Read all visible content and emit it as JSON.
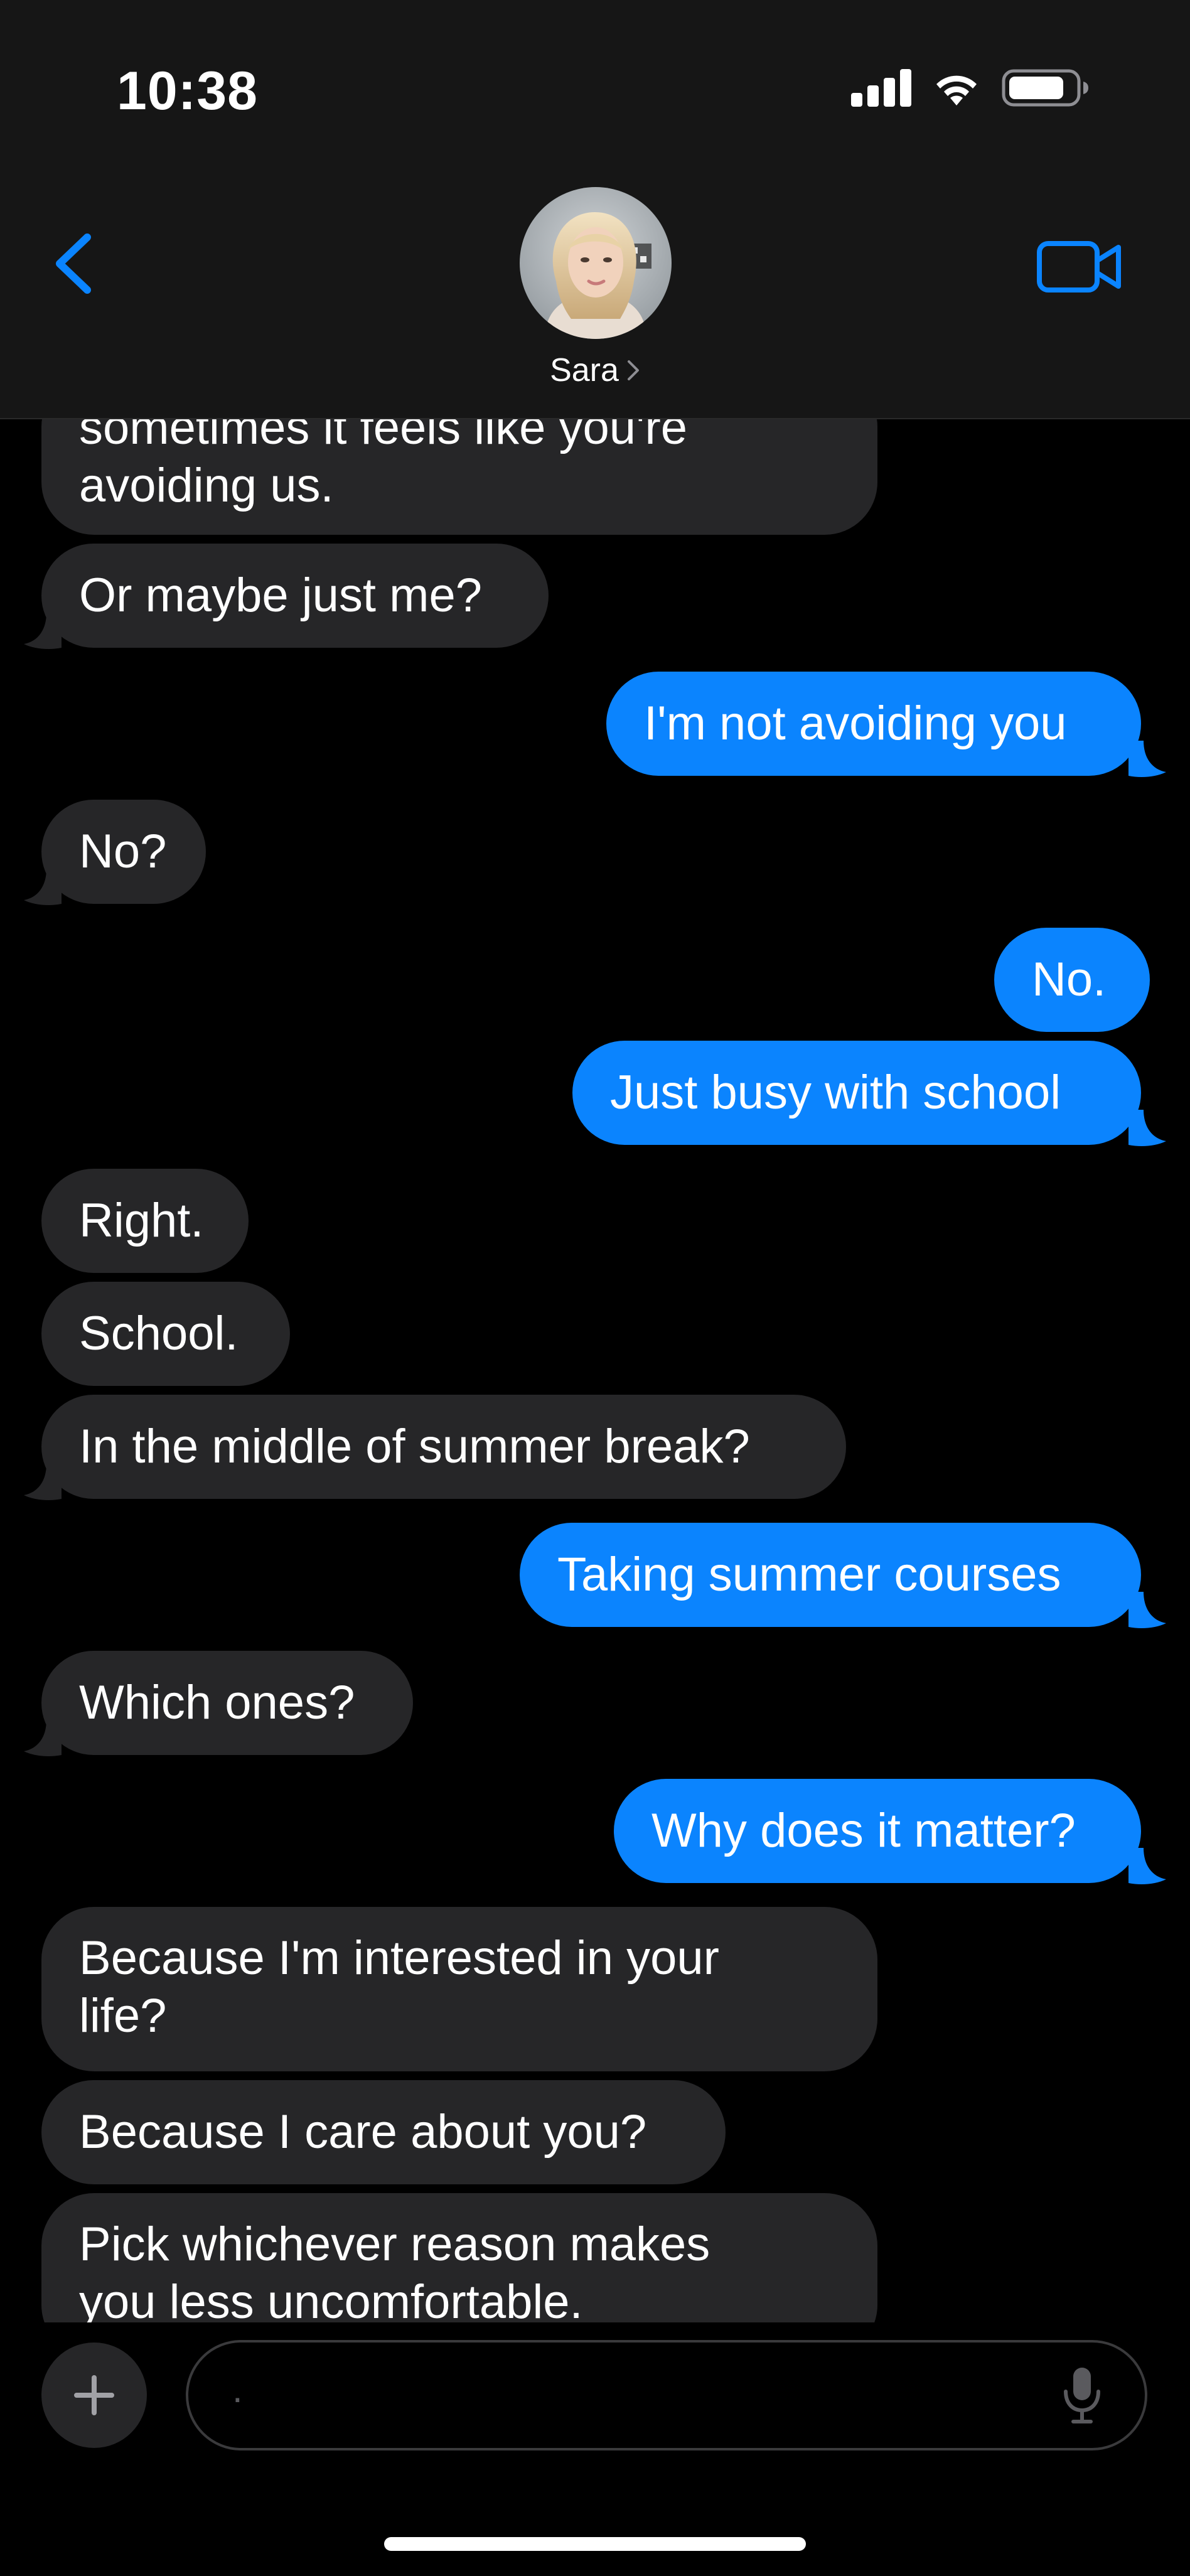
{
  "status_bar": {
    "time": "10:38",
    "icons": [
      "cellular-signal-icon",
      "wifi-icon",
      "battery-icon"
    ]
  },
  "header": {
    "contact_name": "Sara",
    "back_icon": "chevron-left-icon",
    "facetime_icon": "video-camera-icon",
    "name_chevron_icon": "chevron-right-icon"
  },
  "messages": [
    {
      "direction": "received",
      "lines": [
        "sometimes it feels like you're",
        "avoiding us."
      ]
    },
    {
      "direction": "received",
      "text": "Or maybe just me?"
    },
    {
      "direction": "sent",
      "text": "I'm not avoiding you"
    },
    {
      "direction": "received",
      "text": "No?"
    },
    {
      "direction": "sent",
      "text": "No."
    },
    {
      "direction": "sent",
      "text": "Just busy with school"
    },
    {
      "direction": "received",
      "text": "Right."
    },
    {
      "direction": "received",
      "text": "School."
    },
    {
      "direction": "received",
      "text": "In the middle of summer break?"
    },
    {
      "direction": "sent",
      "text": "Taking summer courses"
    },
    {
      "direction": "received",
      "text": "Which ones?"
    },
    {
      "direction": "sent",
      "text": "Why does it matter?"
    },
    {
      "direction": "received",
      "lines": [
        "Because I'm interested in your",
        "life?"
      ]
    },
    {
      "direction": "received",
      "text": "Because I care about you?"
    },
    {
      "direction": "received",
      "lines": [
        "Pick whichever reason makes",
        "you less uncomfortable."
      ]
    }
  ],
  "composer": {
    "placeholder": ".",
    "plus_icon": "plus-icon",
    "mic_icon": "microphone-icon"
  },
  "colors": {
    "header_bg": "#161616",
    "received_bubble": "#262628",
    "sent_bubble": "#0b84fe",
    "accent": "#0a84ff",
    "background": "#000000"
  }
}
